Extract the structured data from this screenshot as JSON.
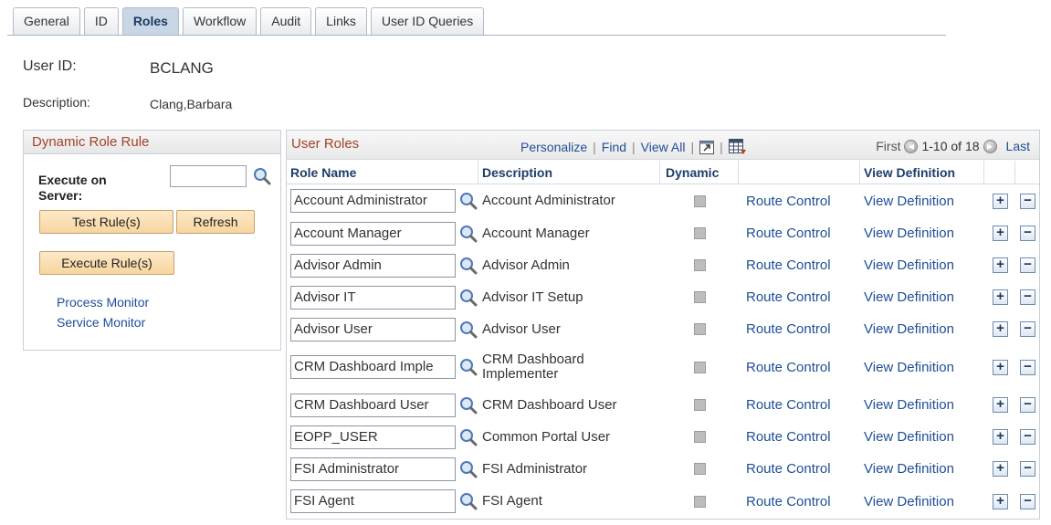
{
  "tabs": [
    {
      "label": "General",
      "active": false
    },
    {
      "label": "ID",
      "active": false
    },
    {
      "label": "Roles",
      "active": true
    },
    {
      "label": "Workflow",
      "active": false
    },
    {
      "label": "Audit",
      "active": false
    },
    {
      "label": "Links",
      "active": false
    },
    {
      "label": "User ID Queries",
      "active": false
    }
  ],
  "header": {
    "user_id_label": "User ID:",
    "user_id_value": "BCLANG",
    "description_label": "Description:",
    "description_value": "Clang,Barbara"
  },
  "dynamic_role_rule": {
    "title": "Dynamic Role Rule",
    "execute_label_1": "Execute on",
    "execute_label_2": "Server:",
    "server_value": "",
    "test_button": "Test Rule(s)",
    "refresh_button": "Refresh",
    "execute_button": "Execute Rule(s)",
    "process_monitor": "Process Monitor",
    "service_monitor": "Service Monitor"
  },
  "user_roles": {
    "title": "User Roles",
    "personalize": "Personalize",
    "find": "Find",
    "view_all": "View All",
    "sep": "|",
    "first": "First",
    "range": "1-10 of 18",
    "last": "Last",
    "columns": {
      "role_name": "Role Name",
      "description": "Description",
      "dynamic": "Dynamic",
      "view_definition": "View Definition"
    },
    "rows": [
      {
        "role": "Account Administrator",
        "desc1": "Account Administrator",
        "desc2": "",
        "route": "Route Control",
        "view": "View Definition"
      },
      {
        "role": "Account Manager",
        "desc1": "Account Manager",
        "desc2": "",
        "route": "Route Control",
        "view": "View Definition"
      },
      {
        "role": "Advisor Admin",
        "desc1": "Advisor Admin",
        "desc2": "",
        "route": "Route Control",
        "view": "View Definition"
      },
      {
        "role": "Advisor IT",
        "desc1": "Advisor IT Setup",
        "desc2": "",
        "route": "Route Control",
        "view": "View Definition"
      },
      {
        "role": "Advisor User",
        "desc1": "Advisor User",
        "desc2": "",
        "route": "Route Control",
        "view": "View Definition"
      },
      {
        "role": "CRM Dashboard Imple",
        "desc1": "CRM Dashboard",
        "desc2": "Implementer",
        "route": "Route Control",
        "view": "View Definition"
      },
      {
        "role": "CRM Dashboard User",
        "desc1": "CRM Dashboard User",
        "desc2": "",
        "route": "Route Control",
        "view": "View Definition"
      },
      {
        "role": "EOPP_USER",
        "desc1": "Common Portal User",
        "desc2": "",
        "route": "Route Control",
        "view": "View Definition"
      },
      {
        "role": "FSI Administrator",
        "desc1": "FSI Administrator",
        "desc2": "",
        "route": "Route Control",
        "view": "View Definition"
      },
      {
        "role": "FSI Agent",
        "desc1": "FSI Agent",
        "desc2": "",
        "route": "Route Control",
        "view": "View Definition"
      }
    ]
  },
  "icons": {
    "lookup": "magnifier-icon",
    "zoom": "zoom-grid-icon",
    "download": "spreadsheet-download-icon",
    "prev": "prev-arrow-icon",
    "next": "next-arrow-icon",
    "add": "plus-icon",
    "remove": "minus-icon"
  }
}
